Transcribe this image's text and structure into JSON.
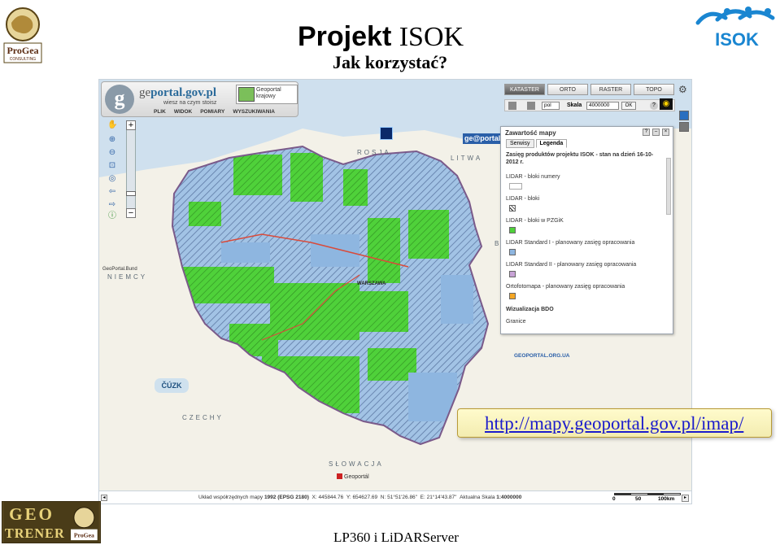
{
  "slide": {
    "title_part1": "Projekt",
    "title_part2": "ISOK",
    "subtitle": "Jak korzystać?",
    "footer": "LP360 i LiDARServer",
    "url": "http://mapy.geoportal.gov.pl/imap/"
  },
  "logos": {
    "progea_top": "ProGea",
    "progea_top_sub": "CONSULTING",
    "isok": "ISOK",
    "geotrener_line1": "GEO",
    "geotrener_line2": "TRENER",
    "geotrener_progea": "ProGea"
  },
  "map_app": {
    "header": {
      "brand_prefix": "ge",
      "brand_suffix": "portal.gov.pl",
      "tagline": "wiesz na czym stoisz",
      "tile_line1": "Geoportal",
      "tile_line2": "krajowy",
      "menu": [
        "PLIK",
        "WIDOK",
        "POMIARY",
        "WYSZUKIWANIA"
      ]
    },
    "tabs": [
      "KATASTER",
      "ORTO",
      "RASTER",
      "TOPO"
    ],
    "active_tab": "KATASTER",
    "toolbar": {
      "language": "pol",
      "scale_label": "Skala",
      "scale_value": "4000000",
      "ok_label": "OK"
    },
    "geoportal_bund": "GeoPortal.Bund",
    "geoportal_banner": "ge@portal.l",
    "countries": {
      "rosja": "ROSJA",
      "litwa": "LITWA",
      "niemcy": "NIEMCY",
      "czechy": "CZECHY",
      "slowacja": "SŁOWACJA",
      "bialorus": "BI"
    },
    "city": "WARSZAWA",
    "cuzk": "ČÚZK",
    "geoportal_org": "GEOPORTAL.ORG.UA",
    "geoportal_sk": "Geoportál",
    "colors": {
      "green": "#4fd13a",
      "blue": "#8eb6e0",
      "hatch": "#2d4f86",
      "land": "#f3f1e8",
      "sea": "#cfe0ee"
    },
    "legend_panel": {
      "title": "Zawartość mapy",
      "tabs": [
        "Serwisy",
        "Legenda"
      ],
      "active_tab": "Legenda",
      "heading": "Zasięg produktów projektu ISOK - stan na dzień 16-10-2012 r.",
      "items": [
        {
          "label": "LIDAR - bloki numery",
          "swatch": "#ffffff"
        },
        {
          "label": "LIDAR - bloki",
          "swatch": "#ffffff"
        },
        {
          "label": "LIDAR - bloki w PZGiK",
          "swatch": "#4fd13a"
        },
        {
          "label": "LIDAR Standard I - planowany zasięg opracowania",
          "swatch": "#8eb6e0"
        },
        {
          "label": "LIDAR Standard II - planowany zasięg opracowania",
          "swatch": "#c8a3d6"
        },
        {
          "label": "Ortofotomapa - planowany zasięg opracowania",
          "swatch": "#f5a623"
        }
      ],
      "section_bdo": "Wizualizacja BDO",
      "granice": "Granice"
    },
    "status": {
      "coord_system_label": "Układ współrzędnych mapy",
      "coord_system": "1992 (EPSG 2180)",
      "x_label": "X:",
      "x_value": "445844.76",
      "y_label": "Y:",
      "y_value": "654627.69",
      "n_label": "N:",
      "n_value": "51°51'26.86\"",
      "e_label": "E:",
      "e_value": "21°14'43.87\"",
      "scale_label": "Aktualna Skala",
      "scale_value": "1:4000000",
      "scalebar_labels": [
        "0",
        "50",
        "100km"
      ]
    }
  }
}
